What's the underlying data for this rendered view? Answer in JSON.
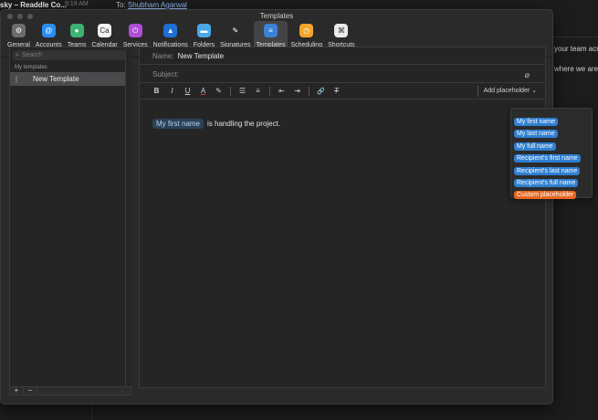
{
  "background": {
    "app_title": "sky – Readdle Co...",
    "time": "9:19 AM",
    "to_label": "To:",
    "to_name": "Shubham Agarwal",
    "text_line1": "your team acro",
    "text_line2": "where we are"
  },
  "window": {
    "title": "Templates"
  },
  "toolbar": [
    {
      "label": "General",
      "icon": "general-icon",
      "color": "#6d6d70",
      "glyph": "⚙"
    },
    {
      "label": "Accounts",
      "icon": "accounts-icon",
      "color": "#2a8cf0",
      "glyph": "@"
    },
    {
      "label": "Teams",
      "icon": "teams-icon",
      "color": "#3cb371",
      "glyph": "●"
    },
    {
      "label": "Calendar",
      "icon": "calendar-icon",
      "color": "#f2f2f2",
      "glyph": "Ca"
    },
    {
      "label": "Services",
      "icon": "services-icon",
      "color": "#b04fd6",
      "glyph": "⏻"
    },
    {
      "label": "Notifications",
      "icon": "notifications-icon",
      "color": "#1f6fd6",
      "glyph": "▲"
    },
    {
      "label": "Folders",
      "icon": "folders-icon",
      "color": "#4aa8e8",
      "glyph": "▬"
    },
    {
      "label": "Signatures",
      "icon": "signatures-icon",
      "color": "#2a2a2b",
      "glyph": "✎"
    },
    {
      "label": "Templates",
      "icon": "templates-icon",
      "color": "#3b82d6",
      "glyph": "≡",
      "active": true
    },
    {
      "label": "Scheduling",
      "icon": "scheduling-icon",
      "color": "#f3a62c",
      "glyph": "◷"
    },
    {
      "label": "Shortcuts",
      "icon": "shortcuts-icon",
      "color": "#e9e9e9",
      "glyph": "⌘"
    }
  ],
  "sidebar": {
    "search_placeholder": "Search",
    "section_label": "My templates",
    "items": [
      {
        "label": "New Template"
      }
    ],
    "add_label": "+",
    "remove_label": "−"
  },
  "editor": {
    "name_label": "Name:",
    "name_value": "New Template",
    "subject_label": "Subject:",
    "subject_value": "",
    "format_buttons": [
      "B",
      "I",
      "U",
      "A",
      "✎",
      "☰",
      "≡",
      "⇤",
      "⇥",
      "🔗",
      "T"
    ],
    "add_placeholder_label": "Add placeholder",
    "body_placeholder_chip": "My first name",
    "body_text": "is handling the project."
  },
  "placeholder_menu": [
    {
      "label": "My first name",
      "color": "#2f7fd0"
    },
    {
      "label": "My last name",
      "color": "#2f7fd0"
    },
    {
      "label": "My full name",
      "color": "#2f7fd0"
    },
    {
      "label": "Recipient's first name",
      "color": "#2f7fd0"
    },
    {
      "label": "Recipient's last name",
      "color": "#2f7fd0"
    },
    {
      "label": "Recipient's full name",
      "color": "#2f7fd0"
    },
    {
      "label": "Custom placeholder",
      "color": "#e5671f"
    }
  ]
}
